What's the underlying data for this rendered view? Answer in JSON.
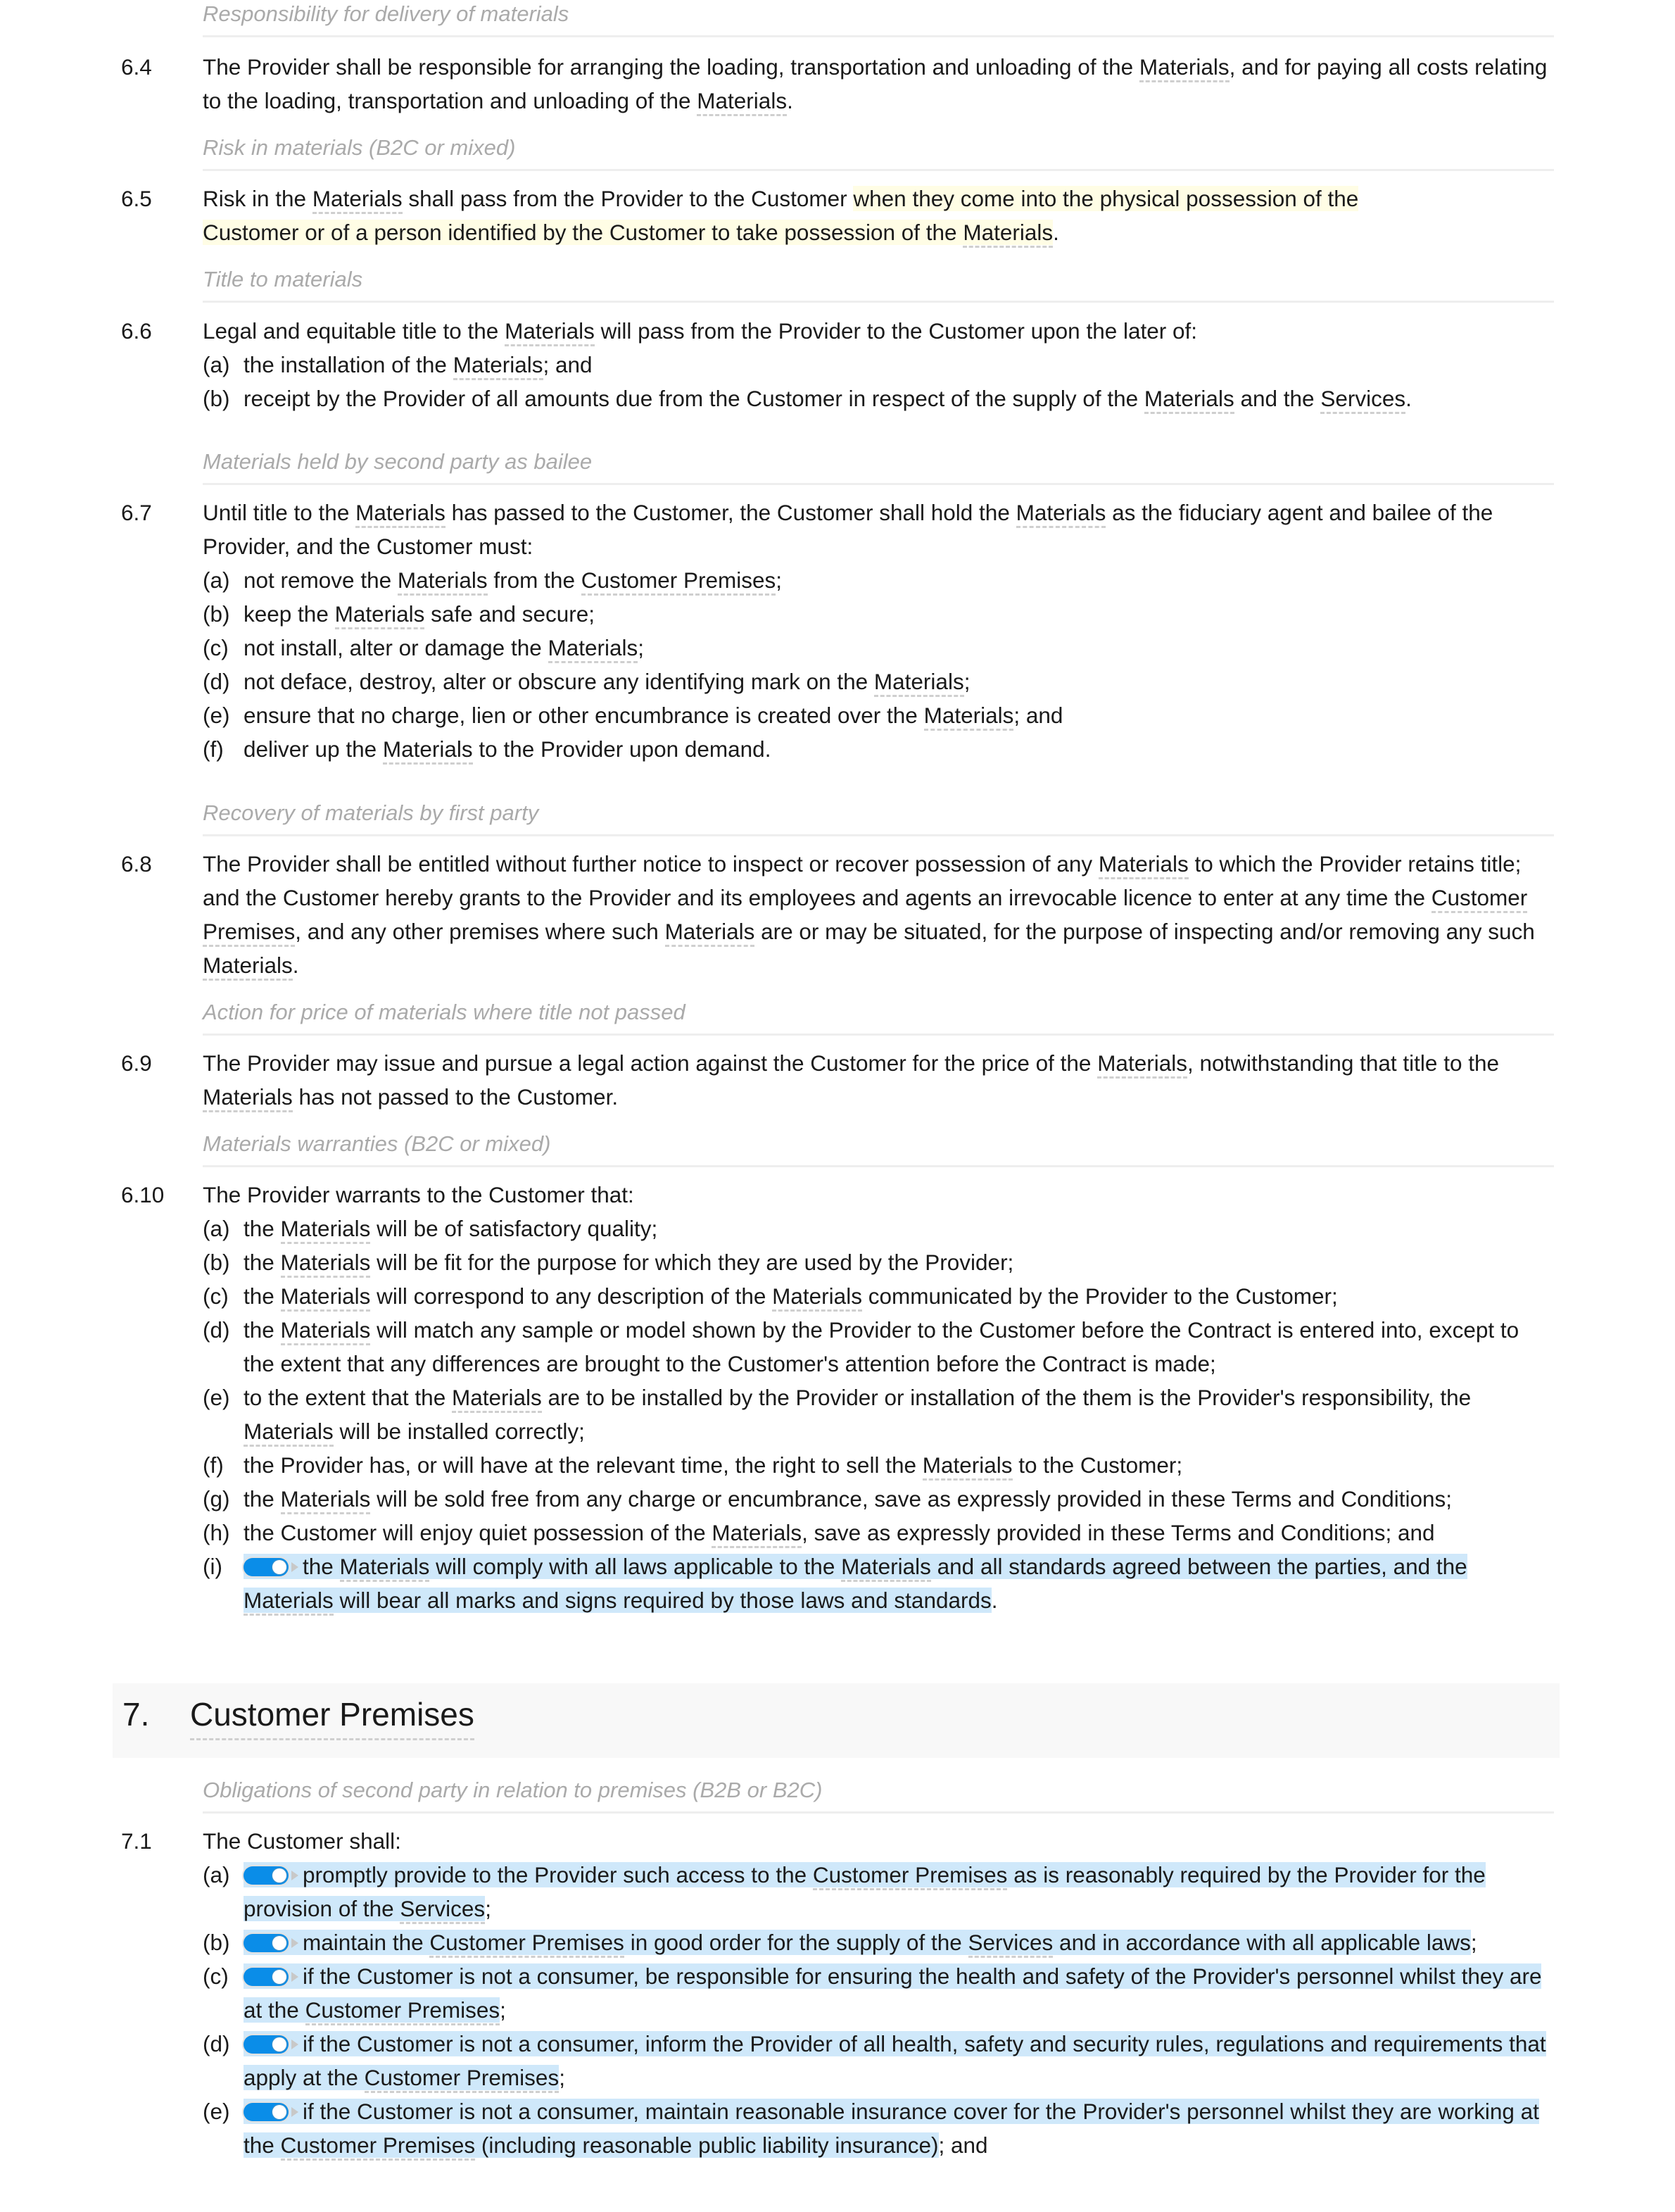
{
  "section6": {
    "items": [
      {
        "label": "Responsibility for delivery of materials",
        "number": "6.4",
        "text": [
          "The Provider shall be responsible for arranging the loading, transportation and unloading of the ",
          {
            "term": "Materials"
          },
          ", and for paying all costs relating to the loading, transportation and unloading of the ",
          {
            "term": "Materials"
          },
          "."
        ]
      },
      {
        "label": "Risk in materials (B2C or mixed)",
        "number": "6.5",
        "text": [
          "Risk in the ",
          {
            "term": "Materials"
          },
          " shall pass from the Provider to the Customer ",
          {
            "highlight": [
              "when they come into the physical possession of the Customer or of a person identified by the Customer to take possession of the ",
              {
                "term": "Materials"
              }
            ]
          },
          "."
        ]
      },
      {
        "label": "Title to materials",
        "number": "6.6",
        "text": [
          "Legal and equitable title to the ",
          {
            "term": "Materials"
          },
          " will pass from the Provider to the Customer upon the later of:"
        ],
        "subs": [
          {
            "letter": "(a)",
            "text": [
              "the installation of the ",
              {
                "term": "Materials"
              },
              "; and"
            ]
          },
          {
            "letter": "(b)",
            "text": [
              "receipt by the Provider of all amounts due from the Customer in respect of the supply of the ",
              {
                "term": "Materials"
              },
              " and the ",
              {
                "term": "Services"
              },
              "."
            ]
          }
        ]
      },
      {
        "label": "Materials held by second party as bailee",
        "number": "6.7",
        "text": [
          "Until title to the ",
          {
            "term": "Materials"
          },
          " has passed to the Customer, the Customer shall hold the ",
          {
            "term": "Materials"
          },
          " as the fiduciary agent and bailee of the Provider, and the Customer must:"
        ],
        "subs": [
          {
            "letter": "(a)",
            "text": [
              "not remove the ",
              {
                "term": "Materials"
              },
              " from the ",
              {
                "term": "Customer Premises"
              },
              ";"
            ]
          },
          {
            "letter": "(b)",
            "text": [
              "keep the ",
              {
                "term": "Materials"
              },
              " safe and secure;"
            ]
          },
          {
            "letter": "(c)",
            "text": [
              "not install, alter or damage the ",
              {
                "term": "Materials"
              },
              ";"
            ]
          },
          {
            "letter": "(d)",
            "text": [
              "not deface, destroy, alter or obscure any identifying mark on the ",
              {
                "term": "Materials"
              },
              ";"
            ]
          },
          {
            "letter": "(e)",
            "text": [
              "ensure that no charge, lien or other encumbrance is created over the ",
              {
                "term": "Materials"
              },
              "; and"
            ]
          },
          {
            "letter": "(f)",
            "text": [
              "deliver up the ",
              {
                "term": "Materials"
              },
              " to the Provider upon demand."
            ]
          }
        ]
      },
      {
        "label": "Recovery of materials by first party",
        "number": "6.8",
        "text": [
          "The Provider shall be entitled without further notice to inspect or recover possession of any ",
          {
            "term": "Materials"
          },
          " to which the Provider retains title; and the Customer hereby grants to the Provider and its employees and agents an irrevocable licence to enter at any time the ",
          {
            "term": "Customer Premises"
          },
          ", and any other premises where such ",
          {
            "term": "Materials"
          },
          " are or may be situated, for the purpose of inspecting and/or removing any such ",
          {
            "term": "Materials"
          },
          "."
        ]
      },
      {
        "label": "Action for price of materials where title not passed",
        "number": "6.9",
        "text": [
          "The Provider may issue and pursue a legal action against the Customer for the price of the ",
          {
            "term": "Materials"
          },
          ", notwithstanding that title to the ",
          {
            "term": "Materials"
          },
          " has not passed to the Customer."
        ]
      },
      {
        "label": "Materials warranties (B2C or mixed)",
        "number": "6.10",
        "text": [
          "The Provider warrants to the Customer that:"
        ],
        "subs": [
          {
            "letter": "(a)",
            "text": [
              "the ",
              {
                "term": "Materials"
              },
              " will be of satisfactory quality;"
            ]
          },
          {
            "letter": "(b)",
            "text": [
              "the ",
              {
                "term": "Materials"
              },
              " will be fit for the purpose for which they are used by the Provider;"
            ]
          },
          {
            "letter": "(c)",
            "text": [
              "the ",
              {
                "term": "Materials"
              },
              " will correspond to any description of the ",
              {
                "term": "Materials"
              },
              " communicated by the Provider to the Customer;"
            ]
          },
          {
            "letter": "(d)",
            "text": [
              "the ",
              {
                "term": "Materials"
              },
              " will match any sample or model shown by the Provider to the Customer before the Contract is entered into, except to the extent that any differences are brought to the Customer's attention before the Contract is made;"
            ]
          },
          {
            "letter": "(e)",
            "text": [
              "to the extent that the ",
              {
                "term": "Materials"
              },
              " are to be installed by the Provider or installation of the them is the Provider's responsibility, the ",
              {
                "term": "Materials"
              },
              " will be installed correctly;"
            ]
          },
          {
            "letter": "(f)",
            "text": [
              "the Provider has, or will have at the relevant time, the right to sell the ",
              {
                "term": "Materials"
              },
              " to the Customer;"
            ]
          },
          {
            "letter": "(g)",
            "text": [
              "the ",
              {
                "term": "Materials"
              },
              " will be sold free from any charge or encumbrance, save as expressly provided in these Terms and Conditions;"
            ]
          },
          {
            "letter": "(h)",
            "text": [
              "the Customer will enjoy quiet possession of the ",
              {
                "term": "Materials"
              },
              ", save as expressly provided in these Terms and Conditions; and"
            ]
          },
          {
            "letter": "(i)",
            "toggle": true,
            "toggle_on": true,
            "text": [
              "the ",
              {
                "term": "Materials"
              },
              " will comply with all laws applicable to the ",
              {
                "term": "Materials"
              },
              " and all standards agreed between the parties, and the ",
              {
                "term": "Materials"
              },
              " will bear all marks and signs required by those laws and standards"
            ],
            "after": "."
          }
        ]
      }
    ]
  },
  "section7": {
    "heading_number": "7.",
    "heading_title": "Customer Premises",
    "items": [
      {
        "label": "Obligations of second party in relation to premises (B2B or B2C)",
        "number": "7.1",
        "text": [
          "The Customer shall:"
        ],
        "subs": [
          {
            "letter": "(a)",
            "toggle": true,
            "toggle_on": true,
            "text": [
              "promptly provide to the Provider such access to the ",
              {
                "term": "Customer Premises"
              },
              " as is reasonably required by the Provider for the provision of the ",
              {
                "term": "Services"
              }
            ],
            "after": ";"
          },
          {
            "letter": "(b)",
            "toggle": true,
            "toggle_on": true,
            "text": [
              "maintain the ",
              {
                "term": "Customer Premises"
              },
              " in good order for the supply of the ",
              {
                "term": "Services"
              },
              " and in accordance with all applicable laws"
            ],
            "after": ";"
          },
          {
            "letter": "(c)",
            "toggle": true,
            "toggle_on": true,
            "text": [
              "if the Customer is not a consumer, be responsible for ensuring the health and safety of the Provider's personnel whilst they are at the ",
              {
                "term": "Customer Premises"
              }
            ],
            "after": ";"
          },
          {
            "letter": "(d)",
            "toggle": true,
            "toggle_on": true,
            "text": [
              "if the Customer is not a consumer, inform the Provider of all health, safety and security rules, regulations and requirements that apply at the ",
              {
                "term": "Customer Premises"
              }
            ],
            "after": ";"
          },
          {
            "letter": "(e)",
            "toggle": true,
            "toggle_on": true,
            "text": [
              "if the Customer is not a consumer, maintain reasonable insurance cover for the Provider's personnel whilst they are working at the ",
              {
                "term": "Customer Premises"
              },
              " (including reasonable public liability insurance)"
            ],
            "after": "; and"
          }
        ]
      }
    ]
  },
  "colors": {
    "toggle_on": "#0a8de8",
    "highlight_optional": "#cfe8fa",
    "highlight_variant": "#fffde5",
    "label_gray": "#aaaaaa"
  }
}
